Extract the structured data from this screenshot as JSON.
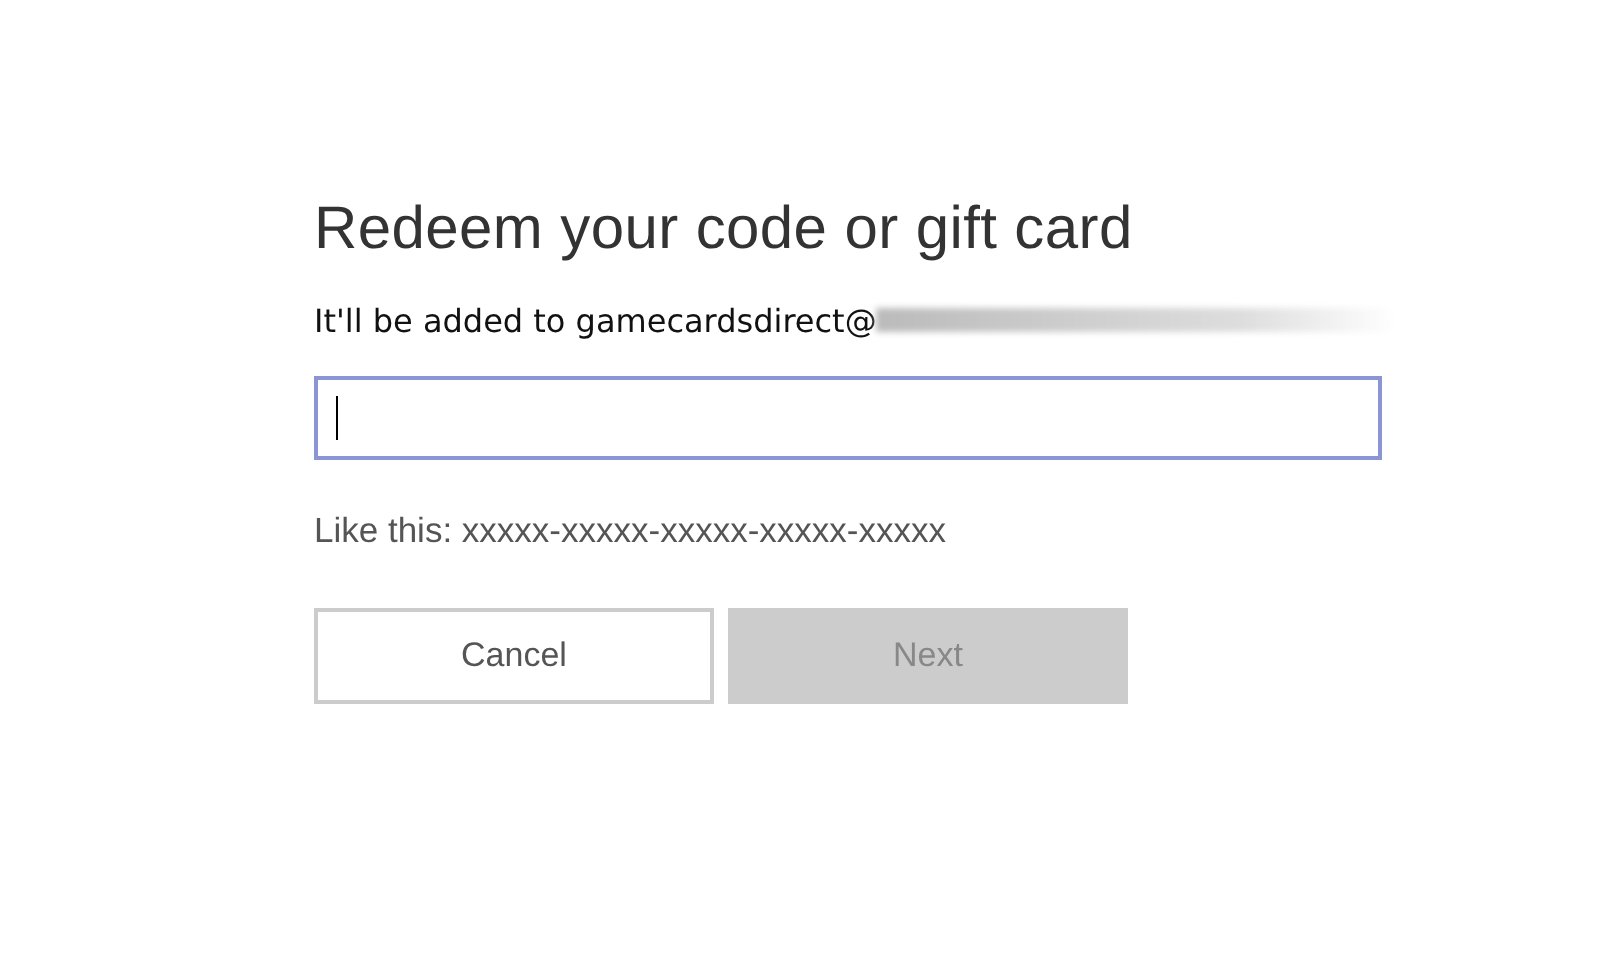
{
  "dialog": {
    "title": "Redeem your code or gift card",
    "account_label": "It'll be added to gamecardsdirect@",
    "account_redacted": true,
    "code_field": {
      "focused": true
    },
    "hint": "Like this: xxxxx-xxxxx-xxxxx-xxxxx-xxxxx",
    "buttons": [
      {
        "label": "Cancel",
        "disabled": false
      },
      {
        "label": "Next",
        "disabled": true
      }
    ]
  }
}
